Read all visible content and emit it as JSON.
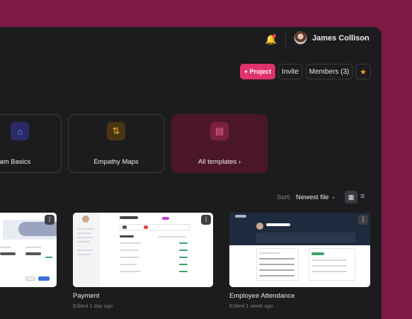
{
  "header": {
    "user_name": "James Collison",
    "bell_icon": "bell-icon",
    "chevron_icon": "chevron-down-icon"
  },
  "actions": {
    "project_label": "+ Project",
    "invite_label": "Invite",
    "members_label": "Members (3)",
    "star_icon": "star-icon"
  },
  "templates": [
    {
      "label": "gram Basics",
      "icon": "droplets-icon"
    },
    {
      "label": "Empathy Maps",
      "icon": "fork-arrows-icon"
    },
    {
      "label": "All templates ›",
      "icon": "stack-icon"
    }
  ],
  "sort": {
    "label": "Sort:",
    "value": "Newest file",
    "grid_icon": "grid-view-icon",
    "list_icon": "list-view-icon"
  },
  "projects": [
    {
      "title": "",
      "subtitle": ""
    },
    {
      "title": "Payment",
      "subtitle": "Edited 1 day ago"
    },
    {
      "title": "Employee Attendance",
      "subtitle": "Edited 1 week ago"
    }
  ],
  "colors": {
    "background": "#7c1a45",
    "panel": "#1c1c1e",
    "accent": "#e0336c",
    "star": "#f0a31c"
  }
}
